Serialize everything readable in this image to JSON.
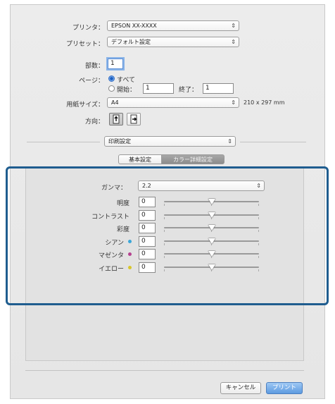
{
  "printer": {
    "label": "プリンタ：",
    "value": "EPSON XX-XXXX"
  },
  "preset": {
    "label": "プリセット：",
    "value": "デフォルト設定"
  },
  "copies": {
    "label": "部数：",
    "value": "1"
  },
  "pages": {
    "label": "ページ：",
    "all_label": "すべて",
    "from_label": "開始：",
    "from_value": "1",
    "to_label": "終了：",
    "to_value": "1"
  },
  "paper_size": {
    "label": "用紙サイズ：",
    "value": "A4",
    "dims": "210 x 297 mm"
  },
  "orientation": {
    "label": "方向："
  },
  "section": {
    "value": "印刷設定"
  },
  "tabs": {
    "basic": "基本設定",
    "color": "カラー詳細設定"
  },
  "gamma": {
    "label": "ガンマ：",
    "value": "2.2"
  },
  "adjustments": [
    {
      "label": "明度",
      "value": "0",
      "level": 0.5
    },
    {
      "label": "コントラスト",
      "value": "0",
      "level": 0.5
    },
    {
      "label": "彩度",
      "value": "0",
      "level": 0.5
    },
    {
      "label": "シアン",
      "value": "0",
      "level": 0.5,
      "dot": "#3aa6d8"
    },
    {
      "label": "マゼンタ",
      "value": "0",
      "level": 0.5,
      "dot": "#b5418f"
    },
    {
      "label": "イエロー",
      "value": "0",
      "level": 0.5,
      "dot": "#d8c62a"
    }
  ],
  "buttons": {
    "cancel": "キャンセル",
    "print": "プリント"
  },
  "colors": {
    "highlight": "#1f5d8f",
    "accent": "#5d9ae0"
  }
}
